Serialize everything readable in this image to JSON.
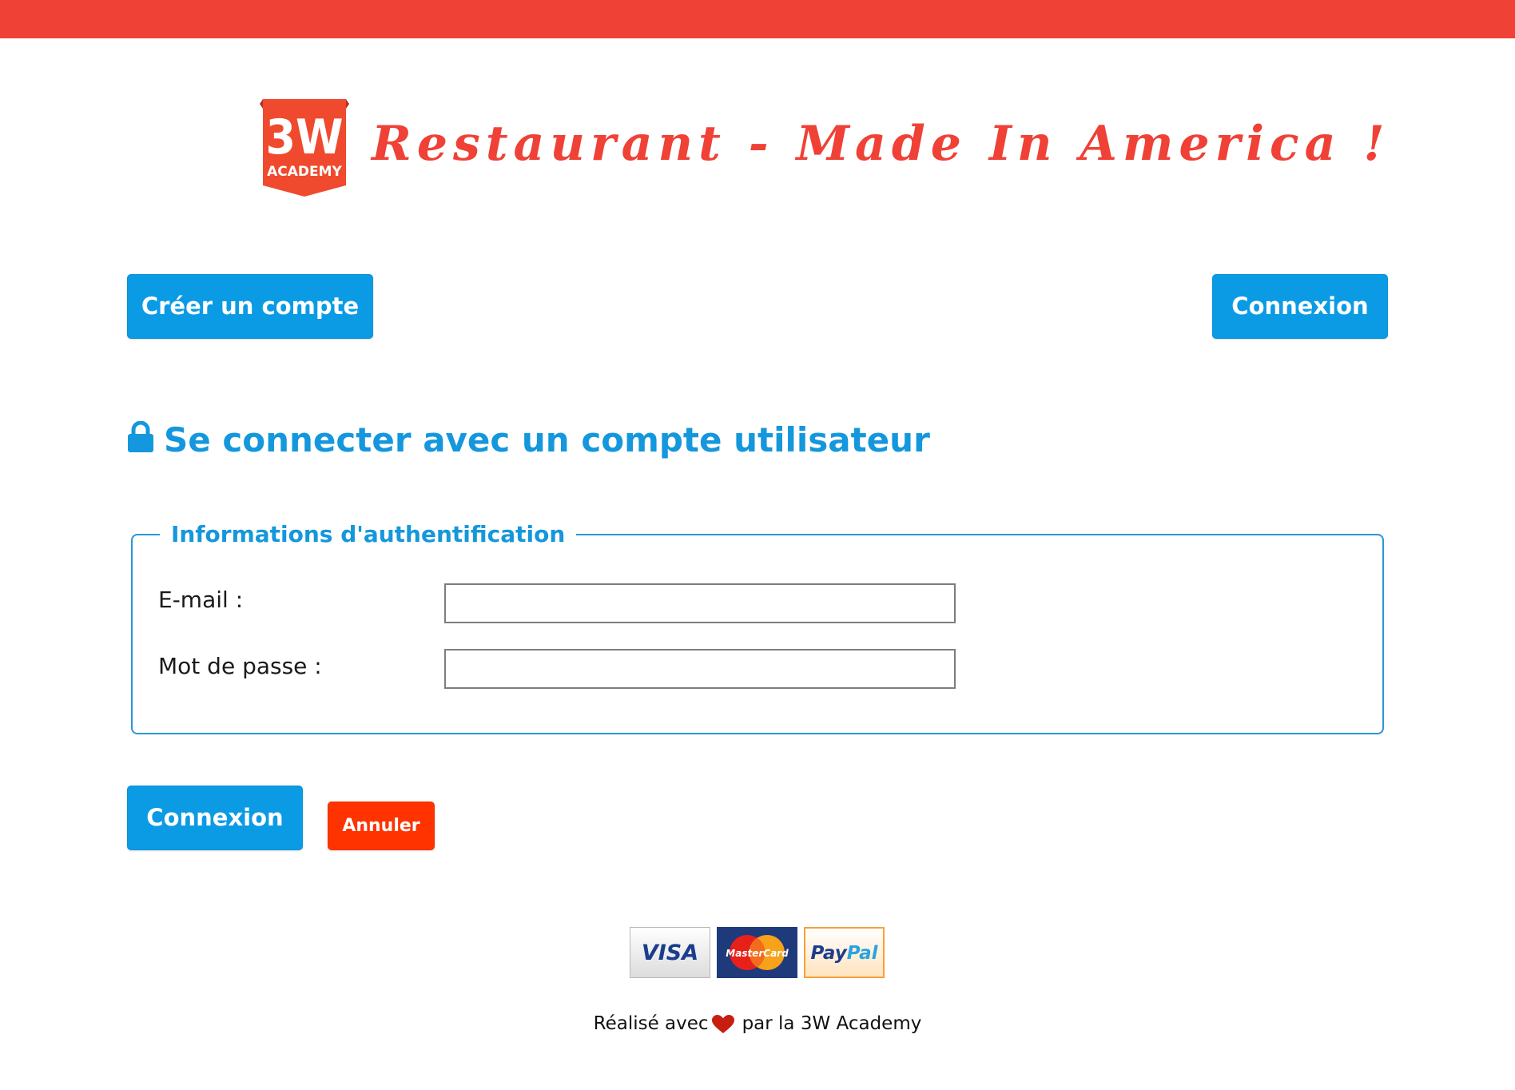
{
  "header": {
    "logo_text_top": "3W",
    "logo_text_bottom": "ACADEMY",
    "title": "Restaurant - Made In America !"
  },
  "nav": {
    "register_label": "Créer un compte",
    "login_label": "Connexion"
  },
  "login": {
    "heading": "Se connecter avec un compte utilisateur",
    "fieldset_legend": "Informations d'authentification",
    "email_label": "E-mail :",
    "email_value": "",
    "password_label": "Mot de passe :",
    "password_value": "",
    "submit_label": "Connexion",
    "cancel_label": "Annuler"
  },
  "payments": {
    "visa": "VISA",
    "mastercard": "MasterCard",
    "paypal_pay": "Pay",
    "paypal_pal": "Pal"
  },
  "footer": {
    "made_with": "Réalisé avec",
    "by": "par la 3W Academy"
  },
  "colors": {
    "brand_red": "#ef4136",
    "primary_blue": "#0b9be5",
    "cancel_red": "#ff3300"
  }
}
